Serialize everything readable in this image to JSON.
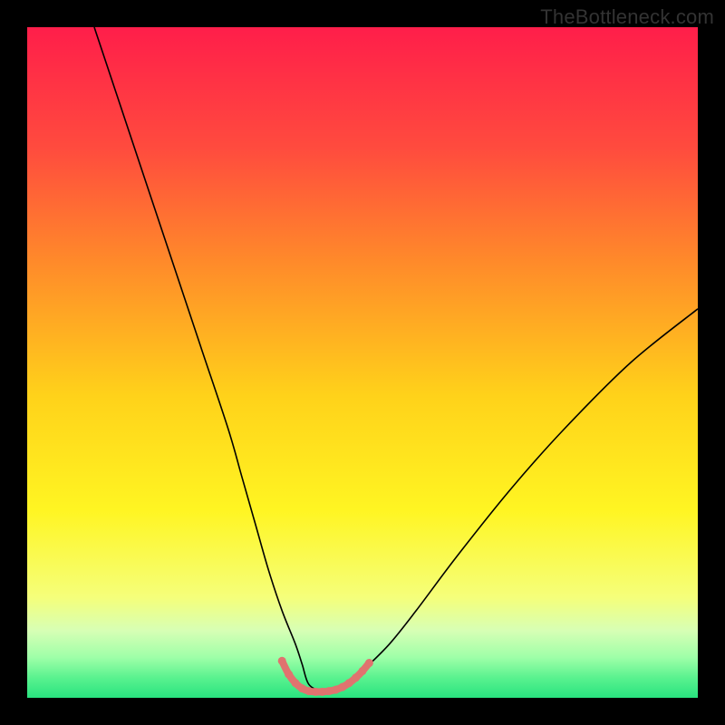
{
  "watermark": "TheBottleneck.com",
  "chart_data": {
    "type": "line",
    "title": "",
    "xlabel": "",
    "ylabel": "",
    "xlim": [
      0,
      100
    ],
    "ylim": [
      0,
      100
    ],
    "grid": false,
    "legend": false,
    "background": {
      "type": "vertical-gradient",
      "stops": [
        {
          "pos": 0.0,
          "color": "#ff1e4a"
        },
        {
          "pos": 0.18,
          "color": "#ff4b3e"
        },
        {
          "pos": 0.35,
          "color": "#ff8a2a"
        },
        {
          "pos": 0.55,
          "color": "#ffd21a"
        },
        {
          "pos": 0.72,
          "color": "#fff522"
        },
        {
          "pos": 0.85,
          "color": "#f5ff7a"
        },
        {
          "pos": 0.9,
          "color": "#d7ffb5"
        },
        {
          "pos": 0.94,
          "color": "#9effa8"
        },
        {
          "pos": 0.97,
          "color": "#5af28f"
        },
        {
          "pos": 1.0,
          "color": "#29e37f"
        }
      ]
    },
    "series": [
      {
        "name": "bottleneck-curve",
        "color": "#000000",
        "width": 1.6,
        "x": [
          10,
          14,
          18,
          22,
          26,
          30,
          32,
          34,
          36,
          38,
          40,
          41,
          42,
          44,
          46,
          48,
          50,
          54,
          58,
          64,
          72,
          80,
          90,
          100
        ],
        "y": [
          100,
          88,
          76,
          64,
          52,
          40,
          33,
          26,
          19,
          13,
          8,
          5,
          2,
          1,
          1,
          2,
          4,
          8,
          13,
          21,
          31,
          40,
          50,
          58
        ]
      },
      {
        "name": "optimal-marker",
        "color": "#e0736f",
        "width": 8,
        "cap": "round",
        "x": [
          38,
          39,
          40,
          41,
          42,
          43,
          44,
          45,
          46,
          47,
          48,
          49,
          50,
          51
        ],
        "y": [
          5.5,
          3.5,
          2.2,
          1.4,
          1.0,
          0.9,
          0.9,
          1.0,
          1.2,
          1.6,
          2.2,
          3.0,
          4.0,
          5.2
        ]
      }
    ],
    "annotations": []
  }
}
